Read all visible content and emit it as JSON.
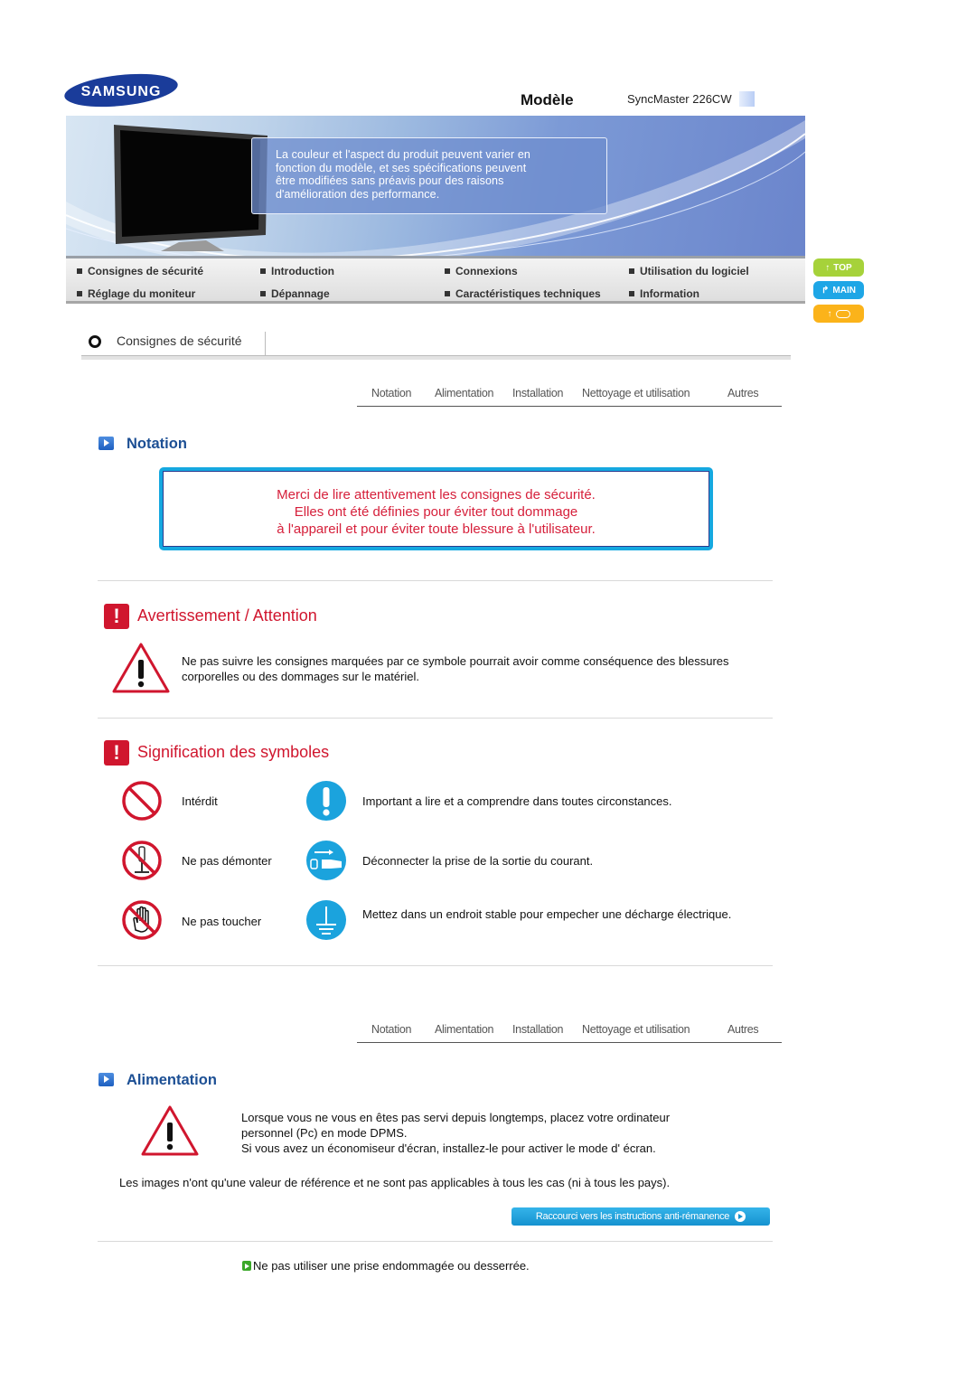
{
  "header": {
    "brand": "SAMSUNG",
    "model_label": "Modèle",
    "model_value": "SyncMaster 226CW"
  },
  "banner": {
    "lines": [
      "La couleur et l'aspect du produit peuvent varier en",
      "fonction du modèle, et ses spécifications peuvent",
      "être modifiées sans préavis pour des raisons",
      "d'amélioration des performance."
    ]
  },
  "main_nav": {
    "items": [
      {
        "label": "Consignes de sécurité"
      },
      {
        "label": "Introduction"
      },
      {
        "label": "Connexions"
      },
      {
        "label": "Utilisation du logiciel"
      },
      {
        "label": "Réglage du moniteur"
      },
      {
        "label": "Dépannage"
      },
      {
        "label": "Caractéristiques techniques"
      },
      {
        "label": "Information"
      }
    ]
  },
  "side_buttons": {
    "top": "TOP",
    "main": "MAIN",
    "back": ""
  },
  "section": {
    "title": "Consignes de sécurité"
  },
  "subtabs": [
    "Notation",
    "Alimentation",
    "Installation",
    "Nettoyage et utilisation",
    "Autres"
  ],
  "notation": {
    "heading": "Notation",
    "notice_lines": [
      "Merci de lire attentivement les consignes de sécurité.",
      "Elles ont été définies pour éviter tout dommage",
      "à l'appareil et pour éviter toute blessure à l'utilisateur."
    ],
    "warning": {
      "title": "Avertissement / Attention",
      "text": "Ne pas suivre les consignes marquées par ce symbole pourrait avoir comme conséquence des blessures corporelles ou des dommages sur le matériel."
    },
    "symbols": {
      "title": "Signification des symboles",
      "left": [
        {
          "icon": "prohibited-icon",
          "label": "Intérdit"
        },
        {
          "icon": "no-disassemble-icon",
          "label": "Ne pas démonter"
        },
        {
          "icon": "no-touch-icon",
          "label": "Ne pas toucher"
        }
      ],
      "right": [
        {
          "icon": "important-icon",
          "label": "Important a lire et a comprendre dans toutes circonstances."
        },
        {
          "icon": "unplug-icon",
          "label": "Déconnecter la prise de la sortie du courant."
        },
        {
          "icon": "ground-icon",
          "label": "Mettez dans un endroit stable pour empecher une décharge électrique."
        }
      ]
    }
  },
  "alimentation": {
    "heading": "Alimentation",
    "text_lines": [
      "Lorsque vous ne vous en êtes pas servi depuis longtemps, placez votre ordinateur",
      "personnel (Pc) en mode DPMS.",
      "Si vous avez un économiseur d'écran, installez-le pour activer le mode d' écran."
    ],
    "disclaimer": "Les images n'ont qu'une valeur de référence et ne sont pas applicables à tous les cas (ni à tous les pays).",
    "shortcut_button": "Raccourci vers les instructions anti-rémanence",
    "bullet": "Ne pas utiliser une prise endommagée ou desserrée."
  }
}
